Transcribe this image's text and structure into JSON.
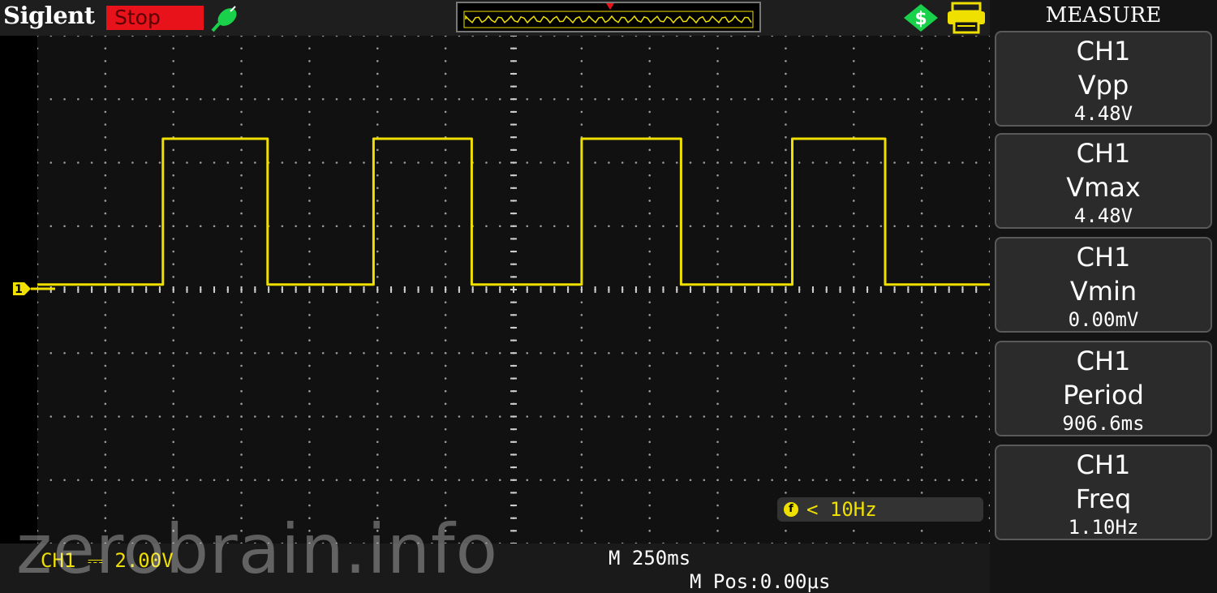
{
  "header": {
    "brand": "Siglent",
    "run_status": "Stop",
    "status_color": "#e8121a"
  },
  "icons": {
    "probe": "probe-icon",
    "usb": "usb-storage-icon",
    "printer": "printer-icon",
    "channel_marker": "channel-1-marker-icon",
    "trigger": "trigger-indicator-icon"
  },
  "sidebar": {
    "title": "MEASURE",
    "measurements": [
      {
        "channel": "CH1",
        "name": "Vpp",
        "value": "4.48V"
      },
      {
        "channel": "CH1",
        "name": "Vmax",
        "value": "4.48V"
      },
      {
        "channel": "CH1",
        "name": "Vmin",
        "value": "0.00mV"
      },
      {
        "channel": "CH1",
        "name": "Period",
        "value": "906.6ms"
      },
      {
        "channel": "CH1",
        "name": "Freq",
        "value": "1.10Hz"
      }
    ]
  },
  "display": {
    "channel_marker_label": "1",
    "trigger_readout": "< 10Hz",
    "trace_color": "#f0e000"
  },
  "footer": {
    "ch1_scale": "CH1 ⎓ 2.00V",
    "timebase": "M 250ms",
    "m_pos": "M Pos:0.00μs"
  },
  "watermark": "zerobrain.info",
  "chart_data": {
    "type": "line",
    "series": [
      {
        "x": [
          -3.2,
          -2.24,
          -2.24,
          -1.44,
          -1.44,
          -0.63,
          -0.63,
          0.12,
          0.12,
          0.96,
          0.96,
          1.72,
          1.72,
          2.57,
          2.57,
          3.28,
          3.28,
          4.08
        ],
        "y": [
          0,
          0,
          4.48,
          4.48,
          0,
          0,
          4.48,
          4.48,
          0,
          0,
          4.48,
          4.48,
          0,
          0,
          4.48,
          4.48,
          0,
          0
        ]
      }
    ],
    "x_unit": "s",
    "y_unit": "V",
    "xlim": [
      -3.2,
      4.08
    ],
    "ylim": [
      -7.8,
      7.8
    ],
    "x_divisions": 14,
    "y_divisions": 8,
    "grid": true
  }
}
